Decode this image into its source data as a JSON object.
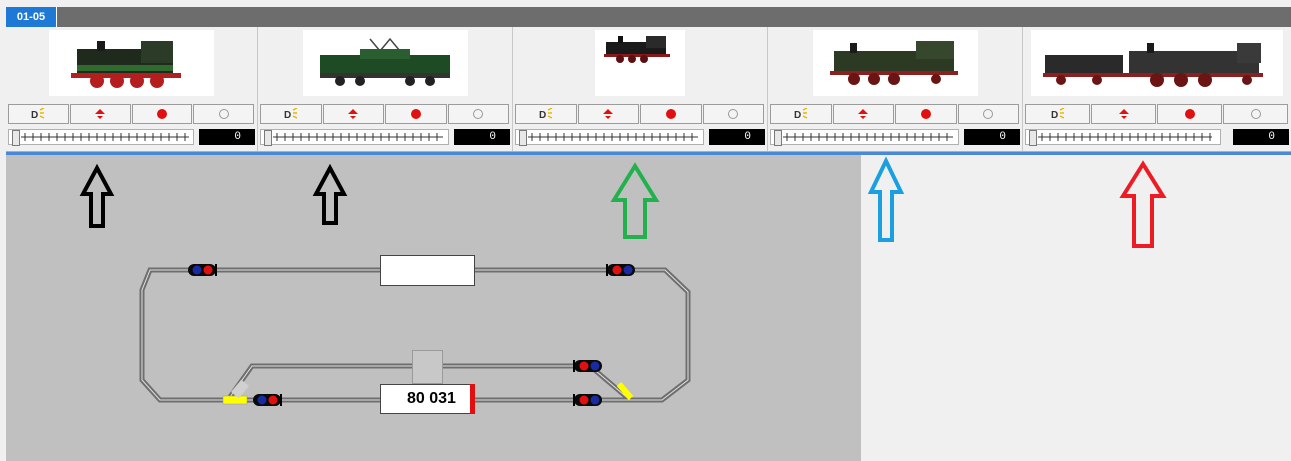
{
  "tabs": [
    {
      "label": "01-05"
    }
  ],
  "locos": [
    {
      "name": "loco-1",
      "speed": "0"
    },
    {
      "name": "loco-2",
      "speed": "0"
    },
    {
      "name": "loco-3",
      "speed": "0"
    },
    {
      "name": "loco-4",
      "speed": "0"
    },
    {
      "name": "loco-5",
      "speed": "0"
    }
  ],
  "block_label": "80 031",
  "arrow_colors": [
    "#000000",
    "#000000",
    "#22b14c",
    "#1aa0e0",
    "#ed1c24"
  ],
  "colors": {
    "tab_active": "#1e78d6",
    "track_bg": "#c0c0c0",
    "signal_red": "#e01010",
    "signal_blue": "#1a2aa0",
    "track_selected": "#ffff00"
  },
  "icons": [
    "headlight-function-icon",
    "direction-icon",
    "stop-icon",
    "emergency-icon"
  ]
}
